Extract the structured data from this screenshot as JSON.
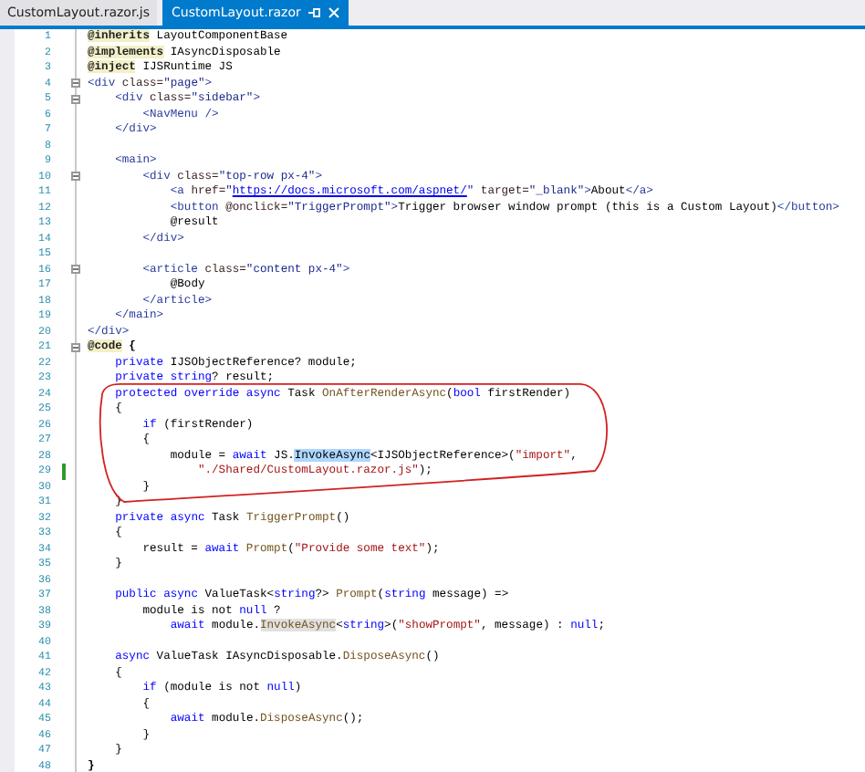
{
  "tabs": [
    {
      "label": "CustomLayout.razor.js",
      "selected": false
    },
    {
      "label": "CustomLayout.razor",
      "selected": true
    }
  ],
  "lines": [
    {
      "number": "1",
      "fold": false,
      "changed": false,
      "tokens": [
        {
          "kind": "directive",
          "text": "@inherits"
        },
        {
          "kind": "plain",
          "text": " LayoutComponentBase"
        }
      ]
    },
    {
      "number": "2",
      "fold": false,
      "changed": false,
      "tokens": [
        {
          "kind": "directive",
          "text": "@implements"
        },
        {
          "kind": "plain",
          "text": " IAsyncDisposable"
        }
      ]
    },
    {
      "number": "3",
      "fold": false,
      "changed": false,
      "tokens": [
        {
          "kind": "directive",
          "text": "@inject"
        },
        {
          "kind": "plain",
          "text": " IJSRuntime JS"
        }
      ]
    },
    {
      "number": "4",
      "fold": true,
      "changed": false,
      "tokens": [
        {
          "kind": "tag",
          "text": "<div"
        },
        {
          "kind": "attr",
          "text": " class="
        },
        {
          "kind": "htmlstring",
          "text": "\"page\""
        },
        {
          "kind": "tag",
          "text": ">"
        }
      ]
    },
    {
      "number": "5",
      "fold": true,
      "changed": false,
      "tokens": [
        {
          "kind": "tag",
          "text": "    <div"
        },
        {
          "kind": "attr",
          "text": " class="
        },
        {
          "kind": "htmlstring",
          "text": "\"sidebar\""
        },
        {
          "kind": "tag",
          "text": ">"
        }
      ]
    },
    {
      "number": "6",
      "fold": false,
      "changed": false,
      "tokens": [
        {
          "kind": "tag",
          "text": "        <NavMenu />"
        }
      ]
    },
    {
      "number": "7",
      "fold": false,
      "changed": false,
      "tokens": [
        {
          "kind": "tag",
          "text": "    </div>"
        }
      ]
    },
    {
      "number": "8",
      "fold": false,
      "changed": false
    },
    {
      "number": "9",
      "fold": false,
      "changed": false,
      "tokens": [
        {
          "kind": "tag",
          "text": "    <main>"
        }
      ]
    },
    {
      "number": "10",
      "fold": true,
      "changed": false,
      "tokens": [
        {
          "kind": "tag",
          "text": "        <div"
        },
        {
          "kind": "attr",
          "text": " class="
        },
        {
          "kind": "htmlstring",
          "text": "\"top-row px-4\""
        },
        {
          "kind": "tag",
          "text": ">"
        }
      ]
    },
    {
      "number": "11",
      "fold": false,
      "changed": false,
      "tokens": [
        {
          "kind": "tag",
          "text": "            <a"
        },
        {
          "kind": "attr",
          "text": " href="
        },
        {
          "kind": "htmlstring",
          "text": "\""
        },
        {
          "kind": "url",
          "text": "https://docs.microsoft.com/aspnet/"
        },
        {
          "kind": "htmlstring",
          "text": "\""
        },
        {
          "kind": "attr",
          "text": " target="
        },
        {
          "kind": "htmlstring",
          "text": "\"_blank\""
        },
        {
          "kind": "tag",
          "text": ">"
        },
        {
          "kind": "plain",
          "text": "About"
        },
        {
          "kind": "tag",
          "text": "</a>"
        }
      ]
    },
    {
      "number": "12",
      "fold": false,
      "changed": false,
      "tokens": [
        {
          "kind": "tag",
          "text": "            <button"
        },
        {
          "kind": "attr",
          "text": " @onclick="
        },
        {
          "kind": "htmlstring",
          "text": "\"TriggerPrompt\""
        },
        {
          "kind": "tag",
          "text": ">"
        },
        {
          "kind": "plain",
          "text": "Trigger browser window prompt (this is a Custom Layout)"
        },
        {
          "kind": "tag",
          "text": "</button>"
        }
      ]
    },
    {
      "number": "13",
      "fold": false,
      "changed": false,
      "tokens": [
        {
          "kind": "plain",
          "text": "            @result"
        }
      ]
    },
    {
      "number": "14",
      "fold": false,
      "changed": false,
      "tokens": [
        {
          "kind": "tag",
          "text": "        </div>"
        }
      ]
    },
    {
      "number": "15",
      "fold": false,
      "changed": false
    },
    {
      "number": "16",
      "fold": true,
      "changed": false,
      "tokens": [
        {
          "kind": "tag",
          "text": "        <article"
        },
        {
          "kind": "attr",
          "text": " class="
        },
        {
          "kind": "htmlstring",
          "text": "\"content px-4\""
        },
        {
          "kind": "tag",
          "text": ">"
        }
      ]
    },
    {
      "number": "17",
      "fold": false,
      "changed": false,
      "tokens": [
        {
          "kind": "plain",
          "text": "            @Body"
        }
      ]
    },
    {
      "number": "18",
      "fold": false,
      "changed": false,
      "tokens": [
        {
          "kind": "tag",
          "text": "        </article>"
        }
      ]
    },
    {
      "number": "19",
      "fold": false,
      "changed": false,
      "tokens": [
        {
          "kind": "tag",
          "text": "    </main>"
        }
      ]
    },
    {
      "number": "20",
      "fold": false,
      "changed": false,
      "tokens": [
        {
          "kind": "tag",
          "text": "</div>"
        }
      ]
    },
    {
      "number": "21",
      "fold": true,
      "changed": false,
      "tokens": [
        {
          "kind": "directive",
          "text": "@code"
        },
        {
          "kind": "bold",
          "text": " {"
        }
      ]
    },
    {
      "number": "22",
      "fold": false,
      "changed": false,
      "tokens": [
        {
          "kind": "keyword",
          "text": "    private"
        },
        {
          "kind": "plain",
          "text": " IJSObjectReference? module;"
        }
      ]
    },
    {
      "number": "23",
      "fold": false,
      "changed": false,
      "tokens": [
        {
          "kind": "keyword",
          "text": "    private string"
        },
        {
          "kind": "plain",
          "text": "? result;"
        }
      ]
    },
    {
      "number": "24",
      "fold": false,
      "changed": false,
      "tokens": [
        {
          "kind": "keyword",
          "text": "    protected override async"
        },
        {
          "kind": "plain",
          "text": " Task "
        },
        {
          "kind": "method",
          "text": "OnAfterRenderAsync"
        },
        {
          "kind": "plain",
          "text": "("
        },
        {
          "kind": "keyword",
          "text": "bool"
        },
        {
          "kind": "plain",
          "text": " firstRender)"
        }
      ]
    },
    {
      "number": "25",
      "fold": false,
      "changed": false,
      "tokens": [
        {
          "kind": "plain",
          "text": "    {"
        }
      ]
    },
    {
      "number": "26",
      "fold": false,
      "changed": false,
      "tokens": [
        {
          "kind": "keyword",
          "text": "        if"
        },
        {
          "kind": "plain",
          "text": " (firstRender)"
        }
      ]
    },
    {
      "number": "27",
      "fold": false,
      "changed": false,
      "tokens": [
        {
          "kind": "plain",
          "text": "        {"
        }
      ]
    },
    {
      "number": "28",
      "fold": false,
      "changed": false,
      "tokens": [
        {
          "kind": "plain",
          "text": "            module = "
        },
        {
          "kind": "keyword",
          "text": "await"
        },
        {
          "kind": "plain",
          "text": " JS."
        },
        {
          "kind": "selected",
          "text": "InvokeAsync"
        },
        {
          "kind": "plain",
          "text": "<IJSObjectReference>("
        },
        {
          "kind": "string",
          "text": "\"import\""
        },
        {
          "kind": "plain",
          "text": ","
        }
      ]
    },
    {
      "number": "29",
      "fold": false,
      "changed": true,
      "tokens": [
        {
          "kind": "string",
          "text": "                \"./Shared/CustomLayout.razor.js\""
        },
        {
          "kind": "plain",
          "text": ");"
        }
      ]
    },
    {
      "number": "30",
      "fold": false,
      "changed": false,
      "tokens": [
        {
          "kind": "plain",
          "text": "        }"
        }
      ]
    },
    {
      "number": "31",
      "fold": false,
      "changed": false,
      "tokens": [
        {
          "kind": "plain",
          "text": "    }"
        }
      ]
    },
    {
      "number": "32",
      "fold": false,
      "changed": false,
      "tokens": [
        {
          "kind": "keyword",
          "text": "    private async"
        },
        {
          "kind": "plain",
          "text": " Task "
        },
        {
          "kind": "method",
          "text": "TriggerPrompt"
        },
        {
          "kind": "plain",
          "text": "()"
        }
      ]
    },
    {
      "number": "33",
      "fold": false,
      "changed": false,
      "tokens": [
        {
          "kind": "plain",
          "text": "    {"
        }
      ]
    },
    {
      "number": "34",
      "fold": false,
      "changed": false,
      "tokens": [
        {
          "kind": "plain",
          "text": "        result = "
        },
        {
          "kind": "keyword",
          "text": "await"
        },
        {
          "kind": "method",
          "text": " Prompt"
        },
        {
          "kind": "plain",
          "text": "("
        },
        {
          "kind": "string",
          "text": "\"Provide some text\""
        },
        {
          "kind": "plain",
          "text": ");"
        }
      ]
    },
    {
      "number": "35",
      "fold": false,
      "changed": false,
      "tokens": [
        {
          "kind": "plain",
          "text": "    }"
        }
      ]
    },
    {
      "number": "36",
      "fold": false,
      "changed": false
    },
    {
      "number": "37",
      "fold": false,
      "changed": false,
      "tokens": [
        {
          "kind": "keyword",
          "text": "    public async"
        },
        {
          "kind": "plain",
          "text": " ValueTask<"
        },
        {
          "kind": "keyword",
          "text": "string"
        },
        {
          "kind": "plain",
          "text": "?> "
        },
        {
          "kind": "method",
          "text": "Prompt"
        },
        {
          "kind": "plain",
          "text": "("
        },
        {
          "kind": "keyword",
          "text": "string"
        },
        {
          "kind": "plain",
          "text": " message) =>"
        }
      ]
    },
    {
      "number": "38",
      "fold": false,
      "changed": false,
      "tokens": [
        {
          "kind": "plain",
          "text": "        module is not "
        },
        {
          "kind": "keyword",
          "text": "null"
        },
        {
          "kind": "plain",
          "text": " ?"
        }
      ]
    },
    {
      "number": "39",
      "fold": false,
      "changed": false,
      "tokens": [
        {
          "kind": "keyword",
          "text": "            await"
        },
        {
          "kind": "plain",
          "text": " module."
        },
        {
          "kind": "reference",
          "text": "InvokeAsync"
        },
        {
          "kind": "plain",
          "text": "<"
        },
        {
          "kind": "keyword",
          "text": "string"
        },
        {
          "kind": "plain",
          "text": ">("
        },
        {
          "kind": "string",
          "text": "\"showPrompt\""
        },
        {
          "kind": "plain",
          "text": ", message) : "
        },
        {
          "kind": "keyword",
          "text": "null"
        },
        {
          "kind": "plain",
          "text": ";"
        }
      ]
    },
    {
      "number": "40",
      "fold": false,
      "changed": false
    },
    {
      "number": "41",
      "fold": false,
      "changed": false,
      "tokens": [
        {
          "kind": "keyword",
          "text": "    async"
        },
        {
          "kind": "plain",
          "text": " ValueTask IAsyncDisposable."
        },
        {
          "kind": "method",
          "text": "DisposeAsync"
        },
        {
          "kind": "plain",
          "text": "()"
        }
      ]
    },
    {
      "number": "42",
      "fold": false,
      "changed": false,
      "tokens": [
        {
          "kind": "plain",
          "text": "    {"
        }
      ]
    },
    {
      "number": "43",
      "fold": false,
      "changed": false,
      "tokens": [
        {
          "kind": "keyword",
          "text": "        if"
        },
        {
          "kind": "plain",
          "text": " (module is not "
        },
        {
          "kind": "keyword",
          "text": "null"
        },
        {
          "kind": "plain",
          "text": ")"
        }
      ]
    },
    {
      "number": "44",
      "fold": false,
      "changed": false,
      "tokens": [
        {
          "kind": "plain",
          "text": "        {"
        }
      ]
    },
    {
      "number": "45",
      "fold": false,
      "changed": false,
      "tokens": [
        {
          "kind": "keyword",
          "text": "            await"
        },
        {
          "kind": "plain",
          "text": " module."
        },
        {
          "kind": "method",
          "text": "DisposeAsync"
        },
        {
          "kind": "plain",
          "text": "();"
        }
      ]
    },
    {
      "number": "46",
      "fold": false,
      "changed": false,
      "tokens": [
        {
          "kind": "plain",
          "text": "        }"
        }
      ]
    },
    {
      "number": "47",
      "fold": false,
      "changed": false,
      "tokens": [
        {
          "kind": "plain",
          "text": "    }"
        }
      ]
    },
    {
      "number": "48",
      "fold": false,
      "changed": false,
      "tokens": [
        {
          "kind": "bold",
          "text": "}"
        }
      ]
    }
  ]
}
